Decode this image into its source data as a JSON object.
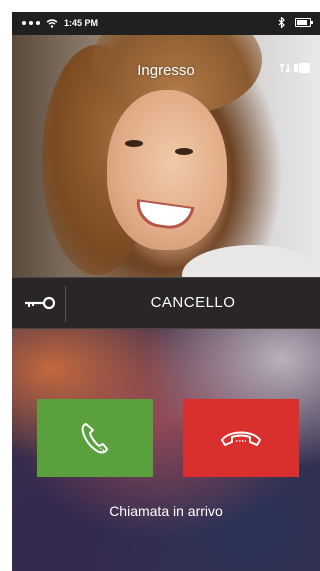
{
  "status_bar": {
    "time": "1:45 PM"
  },
  "video": {
    "title": "Ingresso"
  },
  "gate": {
    "label": "CANCELLO"
  },
  "call": {
    "status": "Chiamata in arrivo"
  },
  "colors": {
    "answer": "#5aa03c",
    "reject": "#d9302e"
  },
  "icons": {
    "answer": "phone-icon",
    "reject": "hang-up-icon",
    "gate": "key-icon",
    "camera": "camera-switch-icon"
  }
}
